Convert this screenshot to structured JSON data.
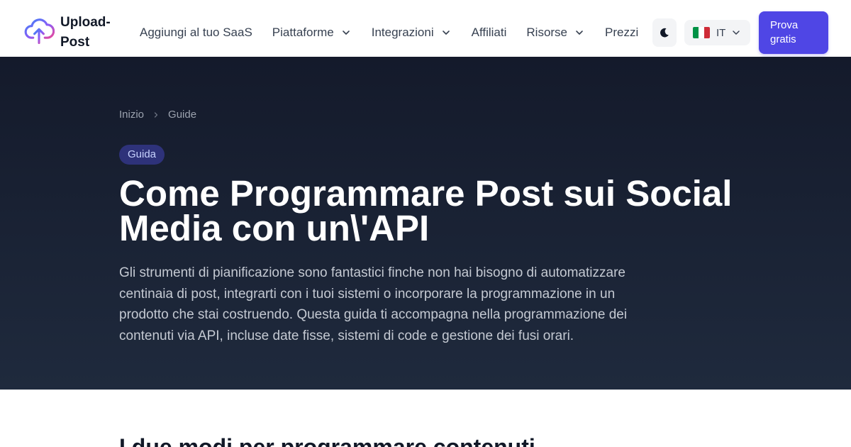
{
  "brand": {
    "name": "Upload-Post",
    "logo_icon": "cloud-upload-icon"
  },
  "nav": {
    "items": [
      {
        "label": "Aggiungi al tuo SaaS",
        "dropdown": false
      },
      {
        "label": "Piattaforme",
        "dropdown": true
      },
      {
        "label": "Integrazioni",
        "dropdown": true
      },
      {
        "label": "Affiliati",
        "dropdown": false
      },
      {
        "label": "Risorse",
        "dropdown": true
      },
      {
        "label": "Prezzi",
        "dropdown": false
      }
    ]
  },
  "theme_toggle": {
    "icon": "moon-icon"
  },
  "language": {
    "code": "IT",
    "flag": "italy-flag-icon"
  },
  "cta": {
    "label": "Prova gratis"
  },
  "breadcrumb": [
    "Inizio",
    "Guide"
  ],
  "hero": {
    "badge": "Guida",
    "title": "Come Programmare Post sui Social Media con un\\'API",
    "lead": "Gli strumenti di pianificazione sono fantastici finche non hai bisogno di automatizzare centinaia di post, integrarti con i tuoi sistemi o incorporare la programmazione in un prodotto che stai costruendo. Questa guida ti accompagna nella programmazione dei contenuti via API, incluse date fisse, sistemi di code e gestione dei fusi orari."
  },
  "section": {
    "title": "I due modi per programmare contenuti"
  },
  "colors": {
    "accent": "#4f46e5",
    "hero_bg": "#1a2233",
    "logo_gradient": [
      "#3b82f6",
      "#8b5cf6",
      "#ec4899"
    ]
  }
}
